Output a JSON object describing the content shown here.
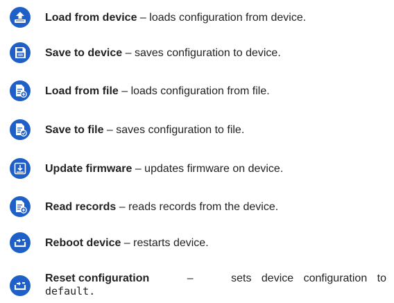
{
  "accent_color": "#1f5fc8",
  "items": [
    {
      "icon": "load-from-device-icon",
      "label": "Load from device",
      "separator": " – ",
      "desc": "loads configuration from device."
    },
    {
      "icon": "save-to-device-icon",
      "label": "Save to device",
      "separator": " – ",
      "desc": "saves configuration to device."
    },
    {
      "icon": "load-from-file-icon",
      "label": "Load from file",
      "separator": " – ",
      "desc": "loads configuration from file."
    },
    {
      "icon": "save-to-file-icon",
      "label": "Save to file",
      "separator": " – ",
      "desc": "saves configuration to file."
    },
    {
      "icon": "update-firmware-icon",
      "label": "Update firmware",
      "separator": " – ",
      "desc": "updates firmware on device."
    },
    {
      "icon": "read-records-icon",
      "label": "Read records",
      "separator": " – ",
      "desc": "reads records from the device."
    },
    {
      "icon": "reboot-device-icon",
      "label": "Reboot device",
      "separator": " – ",
      "desc": "restarts device."
    },
    {
      "icon": "reset-configuration-icon",
      "label": "Reset configuration",
      "separator": " – ",
      "desc": "sets device configuration to",
      "desc_line2": "default."
    }
  ]
}
